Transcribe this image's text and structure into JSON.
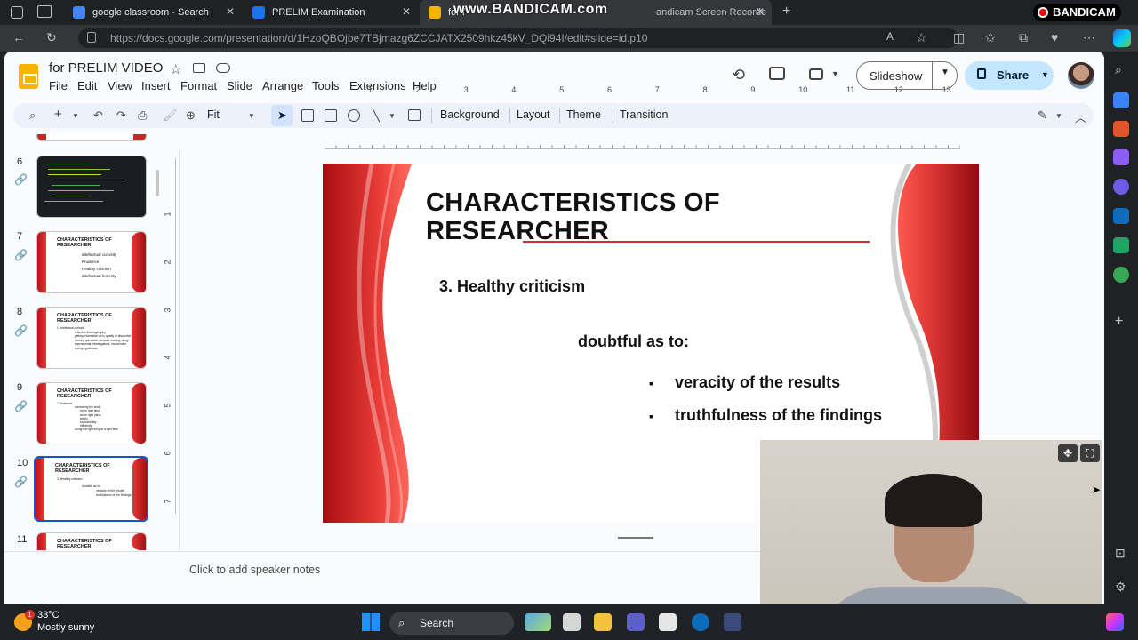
{
  "browser": {
    "tabs": [
      {
        "label": "google classroom - Search",
        "color": "#4285f4"
      },
      {
        "label": "PRELIM Examination",
        "color": "#1a73e8"
      },
      {
        "label": "for PRELIM VIDEO - Google Slides",
        "color": "#f4b400"
      }
    ],
    "url": "https://docs.google.com/presentation/d/1HzoQBOjbe7TBjmazg6ZCCJATX2509hkz45kV_DQi94I/edit#slide=id.p10"
  },
  "recorder": {
    "watermark": "www.BANDICAM.com",
    "tab_overlay": "andicam Screen Recorde",
    "logo": "BANDICAM"
  },
  "app": {
    "doc_title": "for PRELIM VIDEO",
    "menus": [
      "File",
      "Edit",
      "View",
      "Insert",
      "Format",
      "Slide",
      "Arrange",
      "Tools",
      "Extensions",
      "Help"
    ],
    "slideshow_label": "Slideshow",
    "share_label": "Share",
    "toolbar": {
      "zoom": "Fit",
      "background": "Background",
      "layout": "Layout",
      "theme": "Theme",
      "transition": "Transition"
    },
    "ruler_numbers": [
      "1",
      "2",
      "3",
      "4",
      "5",
      "6",
      "7",
      "8",
      "9",
      "10",
      "11",
      "12",
      "13"
    ],
    "vruler_numbers": [
      "1",
      "2",
      "3",
      "4",
      "5",
      "6",
      "7"
    ]
  },
  "filmstrip": {
    "slides": [
      {
        "num": "6",
        "title": "",
        "lines": []
      },
      {
        "num": "7",
        "title": "CHARACTERISTICS OF RESEARCHER",
        "lines": [
          "Intellectual curiosity",
          "Prudence",
          "Healthy criticism",
          "Intellectual honesty"
        ]
      },
      {
        "num": "8",
        "title": "CHARACTERISTICS OF RESEARCHER",
        "lines": [
          "1. Intellectual curiosity",
          "reflective thinking/inquiry",
          "getting information as to quality or discomfort",
          "seeking questions, constant reading, doing experimental, investigations, involvement",
          "testing hypothesis"
        ]
      },
      {
        "num": "9",
        "title": "CHARACTERISTICS OF RESEARCHER",
        "lines": [
          "2. Prudence",
          "conducting the study",
          "at the right time,",
          "at the right place,",
          "wisely,",
          "economically",
          "efficiently",
          "Doing the right thing at a right time"
        ]
      },
      {
        "num": "10",
        "title": "CHARACTERISTICS OF RESEARCHER",
        "lines": [
          "3. Healthy criticism",
          "doubtful as to:",
          "veracity of the results",
          "truthfulness of the findings"
        ]
      },
      {
        "num": "11",
        "title": "CHARACTERISTICS OF RESEARCHER",
        "lines": []
      }
    ]
  },
  "slide": {
    "title": "CHARACTERISTICS OF RESEARCHER",
    "item": "3. Healthy criticism",
    "sub": "doubtful as to:",
    "bullet_char": "▪",
    "bullets": [
      "veracity of the results",
      "truthfulness of the findings"
    ],
    "accent": "#d32f2f"
  },
  "notes_placeholder": "Click to add speaker notes",
  "taskbar": {
    "temperature": "33°C",
    "weather": "Mostly sunny",
    "badge": "1",
    "search": "Search"
  }
}
